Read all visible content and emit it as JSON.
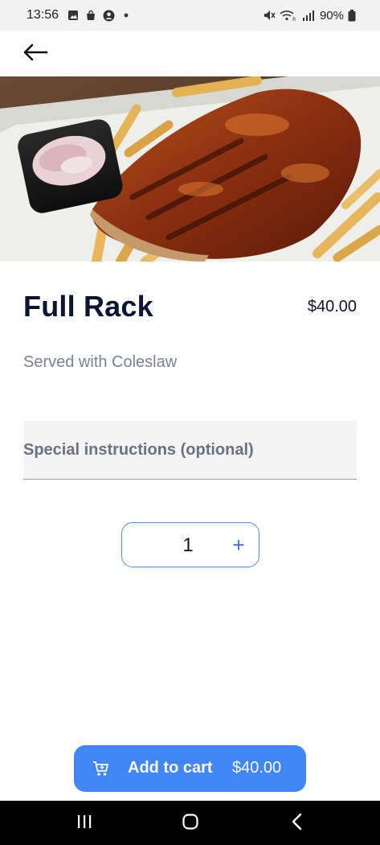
{
  "status_bar": {
    "time": "13:56",
    "battery": "90%",
    "left_icons": [
      "image-icon",
      "shopping-bag-icon",
      "account-circle-icon",
      "dot-icon"
    ],
    "right_icons": [
      "mute-icon",
      "wifi-icon",
      "signal-icon",
      "battery-icon"
    ]
  },
  "app_bar": {
    "back_icon": "arrow-left-icon"
  },
  "item": {
    "title": "Full Rack",
    "price": "$40.00",
    "description": "Served with Coleslaw"
  },
  "special_instructions": {
    "placeholder": "Special instructions (optional)",
    "value": ""
  },
  "quantity": {
    "value": "1",
    "plus": "+"
  },
  "add_to_cart": {
    "label": "Add to cart",
    "price": "$40.00",
    "icon": "cart-icon"
  },
  "colors": {
    "accent": "#4285f4",
    "title_text": "#0b1433",
    "muted_text": "#7b8193",
    "field_bg": "#f4f4f5"
  },
  "nav_bar": {
    "icons": [
      "recent-apps-icon",
      "home-icon",
      "back-icon"
    ]
  }
}
